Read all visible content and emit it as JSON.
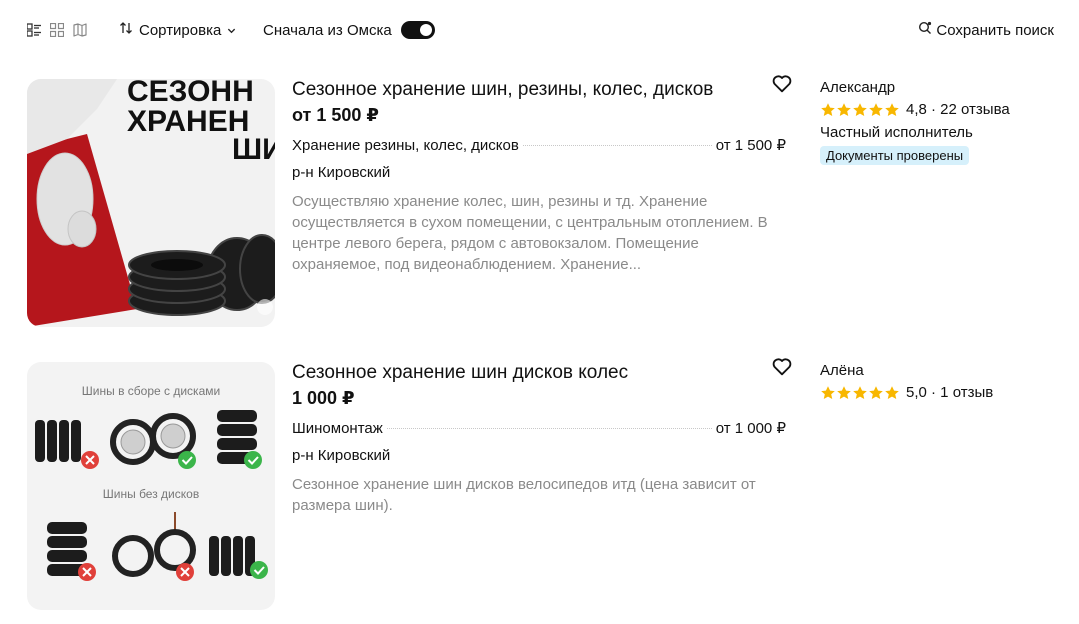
{
  "toolbar": {
    "sort_label": "Сортировка",
    "omsk_label": "Сначала из Омска",
    "omsk_toggle_on": true,
    "save_search_label": "Сохранить поиск"
  },
  "listings": [
    {
      "title": "Сезонное хранение шин, резины, колес, дисков",
      "price": "от 1 500 ₽",
      "service_name": "Хранение резины, колес, дисков",
      "service_price": "от 1 500 ₽",
      "district": "р-н Кировский",
      "description": "Осуществляю хранение колес, шин, резины и тд. Хранение осуществляется в сухом помещении, с центральным отоплением. В центре левого берега, рядом с автовокзалом. Помещение охраняемое, под видеонаблюдением. Хранение...",
      "image_text": [
        "СЕЗОНН",
        "ХРАНЕН",
        "ШИ"
      ],
      "seller_name": "Александр",
      "rating": "4,8 · 22 отзыва",
      "seller_type": "Частный исполнитель",
      "badge": "Документы проверены"
    },
    {
      "title": "Сезонное хранение шин дисков колес",
      "price": "1 000 ₽",
      "service_name": "Шиномонтаж",
      "service_price": "от 1 000 ₽",
      "district": "р-н Кировский",
      "description": "Сезонное хранение шин дисков велосипедов итд (цена зависит от размера шин).",
      "image_text": [
        "Шины в сборе с дисками",
        "Шины без дисков"
      ],
      "seller_name": "Алёна",
      "rating": "5,0 · 1 отзыв",
      "seller_type": "",
      "badge": ""
    }
  ],
  "colors": {
    "star": "#f8b700",
    "badge_bg": "#d6f0fb",
    "desc_text": "#8a8a8a",
    "banner_red": "#b5161c"
  }
}
